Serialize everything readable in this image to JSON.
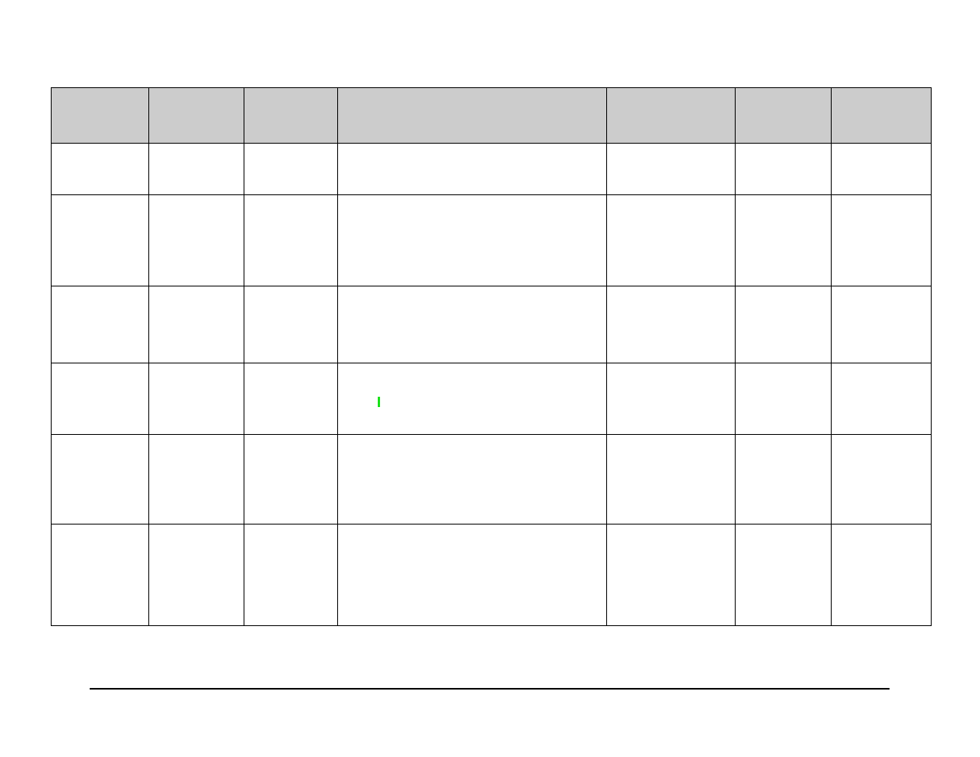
{
  "table": {
    "headers": [
      "",
      "",
      "",
      "",
      "",
      "",
      ""
    ],
    "rows": [
      [
        "",
        "",
        "",
        "",
        "",
        "",
        ""
      ],
      [
        "",
        "",
        "",
        "",
        "",
        "",
        ""
      ],
      [
        "",
        "",
        "",
        "",
        "",
        "",
        ""
      ],
      [
        "",
        "",
        "",
        "I",
        "",
        "",
        ""
      ],
      [
        "",
        "",
        "",
        "",
        "",
        "",
        ""
      ],
      [
        "",
        "",
        "",
        "",
        "",
        "",
        ""
      ]
    ]
  }
}
